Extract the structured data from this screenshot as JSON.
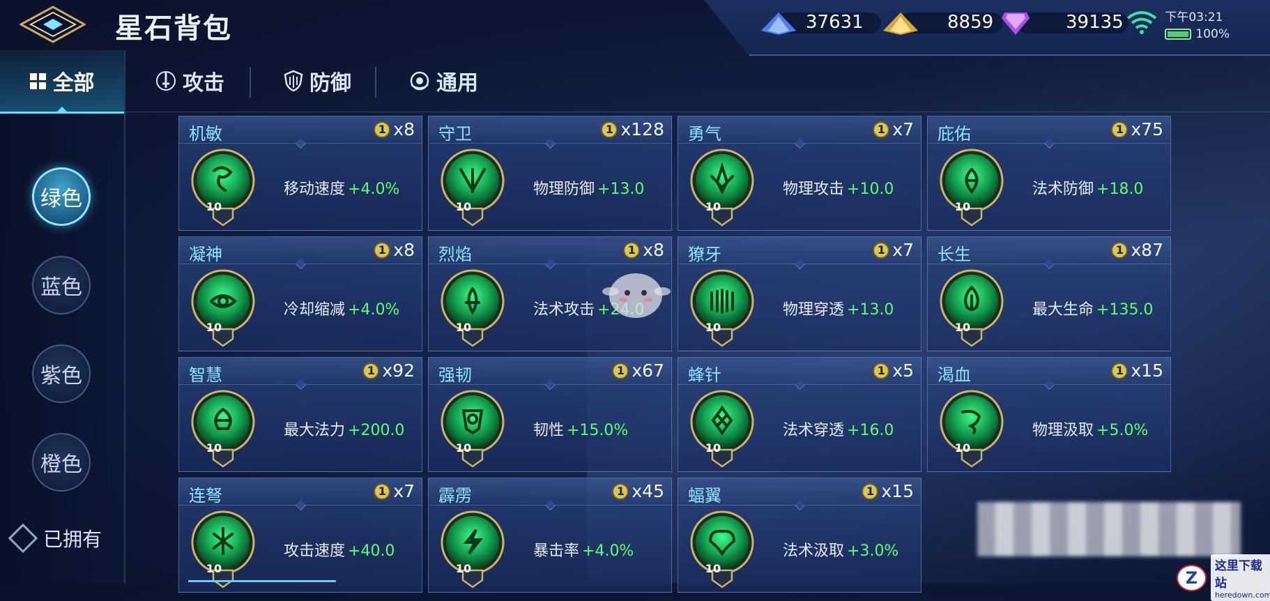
{
  "header": {
    "title": "星石背包",
    "resources": [
      {
        "name": "blue-crystal",
        "value": "37631",
        "color": "#5f8dff"
      },
      {
        "name": "gold-crystal",
        "value": "8859",
        "color": "#f0c14b"
      },
      {
        "name": "purple-diamond",
        "value": "39135",
        "color": "#b864ff"
      }
    ],
    "status": {
      "time": "下午03:21",
      "battery": "100%"
    }
  },
  "sidebar": {
    "all_label": "全部",
    "colors": [
      {
        "label": "绿色",
        "active": true
      },
      {
        "label": "蓝色",
        "active": false
      },
      {
        "label": "紫色",
        "active": false
      },
      {
        "label": "橙色",
        "active": false
      }
    ],
    "owned_label": "已拥有"
  },
  "tabs": [
    {
      "label": "攻击",
      "icon": "sword-icon"
    },
    {
      "label": "防御",
      "icon": "shield-icon"
    },
    {
      "label": "通用",
      "icon": "orb-icon"
    }
  ],
  "inscriptions": [
    {
      "name": "机敏",
      "level_badge": "1",
      "count": "x8",
      "gem_level": "10",
      "stat": "移动速度",
      "bonus": "+4.0%"
    },
    {
      "name": "守卫",
      "level_badge": "1",
      "count": "x128",
      "gem_level": "10",
      "stat": "物理防御",
      "bonus": "+13.0"
    },
    {
      "name": "勇气",
      "level_badge": "1",
      "count": "x7",
      "gem_level": "10",
      "stat": "物理攻击",
      "bonus": "+10.0"
    },
    {
      "name": "庇佑",
      "level_badge": "1",
      "count": "x75",
      "gem_level": "10",
      "stat": "法术防御",
      "bonus": "+18.0"
    },
    {
      "name": "凝神",
      "level_badge": "1",
      "count": "x8",
      "gem_level": "10",
      "stat": "冷却缩减",
      "bonus": "+4.0%"
    },
    {
      "name": "烈焰",
      "level_badge": "1",
      "count": "x8",
      "gem_level": "10",
      "stat": "法术攻击",
      "bonus": "+24.0"
    },
    {
      "name": "獠牙",
      "level_badge": "1",
      "count": "x7",
      "gem_level": "10",
      "stat": "物理穿透",
      "bonus": "+13.0"
    },
    {
      "name": "长生",
      "level_badge": "1",
      "count": "x87",
      "gem_level": "10",
      "stat": "最大生命",
      "bonus": "+135.0"
    },
    {
      "name": "智慧",
      "level_badge": "1",
      "count": "x92",
      "gem_level": "10",
      "stat": "最大法力",
      "bonus": "+200.0"
    },
    {
      "name": "强韧",
      "level_badge": "1",
      "count": "x67",
      "gem_level": "10",
      "stat": "韧性",
      "bonus": "+15.0%"
    },
    {
      "name": "蜂针",
      "level_badge": "1",
      "count": "x5",
      "gem_level": "10",
      "stat": "法术穿透",
      "bonus": "+16.0"
    },
    {
      "name": "渴血",
      "level_badge": "1",
      "count": "x15",
      "gem_level": "10",
      "stat": "物理汲取",
      "bonus": "+5.0%"
    },
    {
      "name": "连弩",
      "level_badge": "1",
      "count": "x7",
      "gem_level": "10",
      "stat": "攻击速度",
      "bonus": "+40.0"
    },
    {
      "name": "霹雳",
      "level_badge": "1",
      "count": "x45",
      "gem_level": "10",
      "stat": "暴击率",
      "bonus": "+4.0%"
    },
    {
      "name": "蝠翼",
      "level_badge": "1",
      "count": "x15",
      "gem_level": "10",
      "stat": "法术汲取",
      "bonus": "+3.0%"
    }
  ],
  "watermark": {
    "site": "这里下载站",
    "domain": "heredown.com",
    "logo": "Z"
  },
  "colors": {
    "accent": "#5fe0ff",
    "gem_green": "#2bd66a",
    "bonus_green": "#5cff6f",
    "name_blue": "#8ee7ff"
  }
}
